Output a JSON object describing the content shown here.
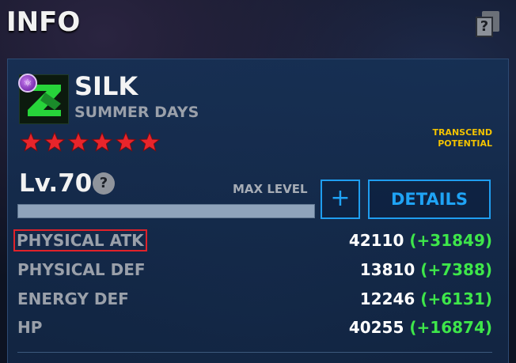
{
  "header": {
    "title": "INFO",
    "help_glyph": "?"
  },
  "hero": {
    "name": "SILK",
    "subtitle": "SUMMER DAYS",
    "class_icon": "cosmic-atom-icon",
    "stars": 6,
    "transcend_label": "TRANSCEND POTENTIAL"
  },
  "level": {
    "label": "Lv.70",
    "help_glyph": "?",
    "max_label": "MAX LEVEL",
    "progress": 1.0,
    "plus_label": "+",
    "details_label": "DETAILS"
  },
  "stats": [
    {
      "name": "PHYSICAL ATK",
      "base": "42110",
      "bonus": "(+31849)",
      "highlighted": true
    },
    {
      "name": "PHYSICAL DEF",
      "base": "13810",
      "bonus": "(+7388)",
      "highlighted": false
    },
    {
      "name": "ENERGY DEF",
      "base": "12246",
      "bonus": "(+6131)",
      "highlighted": false
    },
    {
      "name": "HP",
      "base": "40255",
      "bonus": "(+16874)",
      "highlighted": false
    }
  ],
  "colors": {
    "accent_blue": "#1f9ef0",
    "star_red": "#e8252b",
    "bonus_green": "#3ee64a",
    "transcend_yellow": "#f2c200",
    "highlight_red": "#e0222a"
  }
}
